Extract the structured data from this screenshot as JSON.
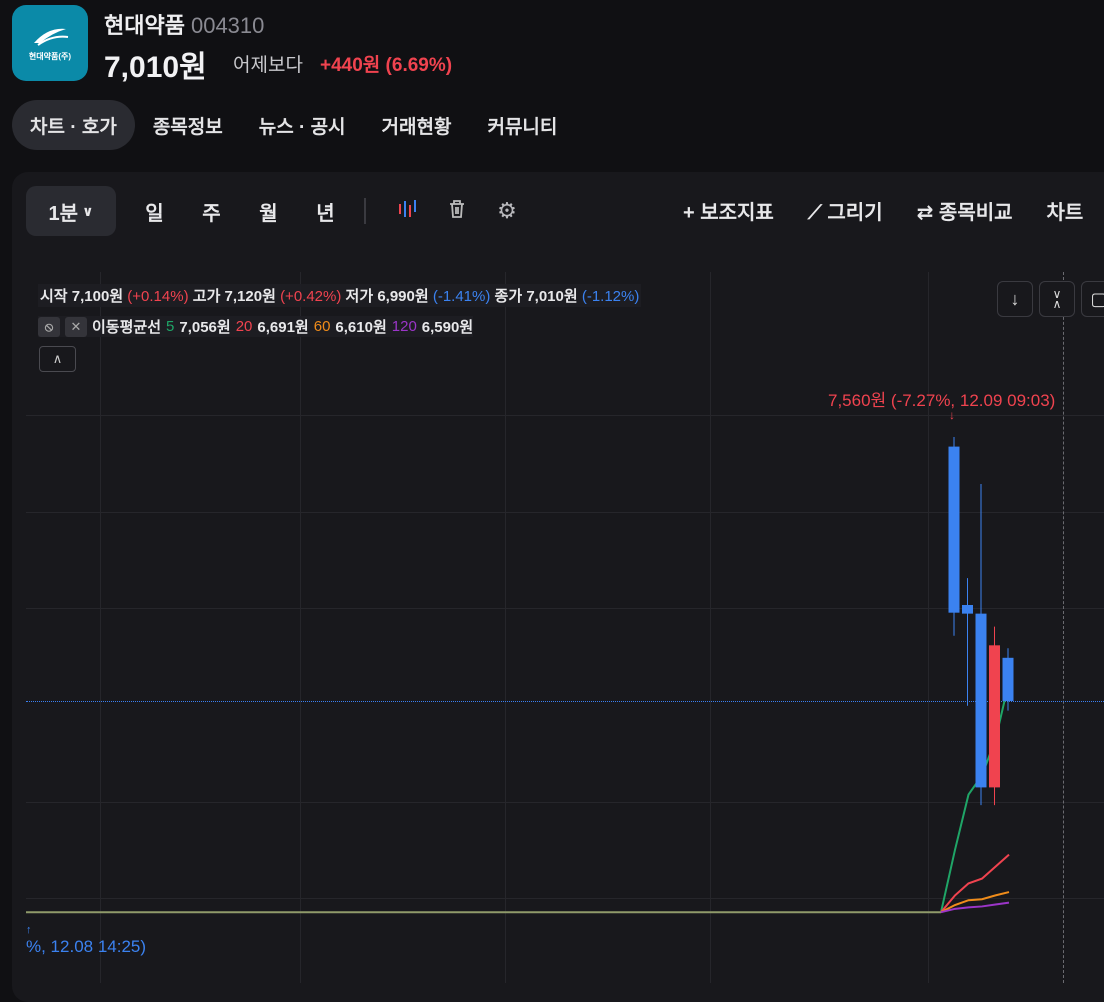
{
  "stock": {
    "logo_text": "현대약품(주)",
    "name": "현대약품",
    "code": "004310",
    "price": "7,010원",
    "vs_label": "어제보다",
    "change": "+440원 (6.69%)"
  },
  "tabs": [
    {
      "label": "차트 · 호가"
    },
    {
      "label": "종목정보"
    },
    {
      "label": "뉴스 · 공시"
    },
    {
      "label": "거래현황"
    },
    {
      "label": "커뮤니티"
    }
  ],
  "toolbar": {
    "interval": "1분",
    "periods": [
      "일",
      "주",
      "월",
      "년"
    ],
    "indicator": "+ 보조지표",
    "draw": "그리기",
    "compare": "⇄ 종목비교",
    "chart_more": "차트"
  },
  "legend": {
    "open_label": "시작",
    "open": "7,100원",
    "open_pct": "(+0.14%)",
    "high_label": "고가",
    "high": "7,120원",
    "high_pct": "(+0.42%)",
    "low_label": "저가",
    "low": "6,990원",
    "low_pct": "(-1.41%)",
    "close_label": "종가",
    "close": "7,010원",
    "close_pct": "(-1.12%)"
  },
  "ma": {
    "label": "이동평균선",
    "p5": "5",
    "v5": "7,056원",
    "p20": "20",
    "v20": "6,691원",
    "p60": "60",
    "v60": "6,610원",
    "p120": "120",
    "v120": "6,590원"
  },
  "annotations": {
    "high": "7,560원 (-7.27%, 12.09 09:03)",
    "low": "%, 12.08 14:25)"
  },
  "colors": {
    "up": "#f0434f",
    "down": "#3b82f0",
    "ma5": "#1fa567",
    "ma20": "#f0434f",
    "ma60": "#f08c1a",
    "ma120": "#9b35c8"
  },
  "chart_data": {
    "type": "candlestick",
    "candles": [
      {
        "o": 7540,
        "h": 7560,
        "l": 7146,
        "c": 7194
      },
      {
        "o": 7210,
        "h": 7266,
        "l": 7000,
        "c": 7192
      },
      {
        "o": 7192,
        "h": 7462,
        "l": 6793,
        "c": 6830
      },
      {
        "o": 6830,
        "h": 7165,
        "l": 6793,
        "c": 7126
      },
      {
        "o": 7100,
        "h": 7120,
        "l": 6990,
        "c": 7010
      }
    ],
    "ma_base": 6570,
    "ma5": [
      6700,
      6815,
      6855,
      6930,
      7050
    ],
    "ma20": [
      6605,
      6630,
      6640,
      6665,
      6690
    ],
    "ma60": [
      6585,
      6595,
      6597,
      6605,
      6612
    ],
    "ma120": [
      6577,
      6580,
      6582,
      6586,
      6590
    ],
    "current": 7010
  }
}
